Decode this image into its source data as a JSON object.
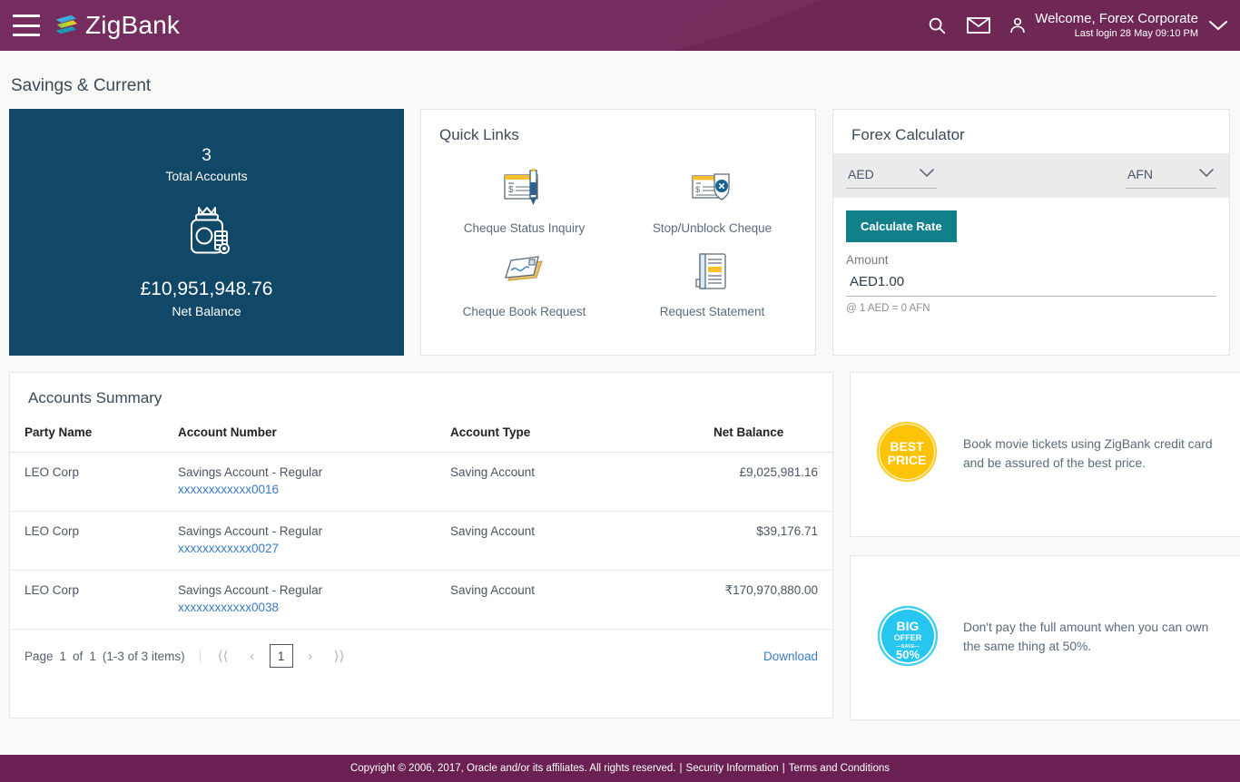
{
  "header": {
    "menu_icon": "hamburger-icon",
    "brand": "ZigBank",
    "search_icon": "search-icon",
    "mail_icon": "envelope-icon",
    "user_icon": "user-avatar-icon",
    "welcome": "Welcome, Forex Corporate",
    "last_login": "Last login 28 May 09:10 PM",
    "caret_icon": "chevron-down-icon",
    "brand_color": "#6b2053"
  },
  "page": {
    "title": "Savings & Current"
  },
  "balance_card": {
    "accounts_count": "3",
    "accounts_label": "Total Accounts",
    "icon": "money-jar-icon",
    "net_balance": "£10,951,948.76",
    "net_balance_label": "Net Balance",
    "bg_color": "#114868"
  },
  "quick_links": {
    "title": "Quick Links",
    "items": [
      {
        "label": "Cheque Status Inquiry",
        "icon": "cheque-pen-icon"
      },
      {
        "label": "Stop/Unblock Cheque",
        "icon": "cheque-block-icon"
      },
      {
        "label": "Cheque Book Request",
        "icon": "cheque-book-icon"
      },
      {
        "label": "Request Statement",
        "icon": "statement-document-icon"
      }
    ]
  },
  "forex": {
    "title": "Forex Calculator",
    "from_currency": "AED",
    "to_currency": "AFN",
    "calculate_label": "Calculate Rate",
    "amount_label": "Amount",
    "amount_value": "AED1.00",
    "rate_note": "@ 1 AED = 0 AFN",
    "button_color": "#12808a"
  },
  "accounts_summary": {
    "title": "Accounts Summary",
    "columns": [
      "Party Name",
      "Account Number",
      "Account Type",
      "Net Balance"
    ],
    "rows": [
      {
        "party": "LEO Corp",
        "account_name": "Savings Account - Regular",
        "account_number": "xxxxxxxxxxxx0016",
        "type": "Saving Account",
        "balance": "£9,025,981.16"
      },
      {
        "party": "LEO Corp",
        "account_name": "Savings Account - Regular",
        "account_number": "xxxxxxxxxxxx0027",
        "type": "Saving Account",
        "balance": "$39,176.71"
      },
      {
        "party": "LEO Corp",
        "account_name": "Savings Account - Regular",
        "account_number": "xxxxxxxxxxxx0038",
        "type": "Saving Account",
        "balance": "₹170,970,880.00"
      }
    ],
    "pagination": {
      "page_word": "Page",
      "current_page": "1",
      "of_word": "of",
      "total_pages": "1",
      "items_text": "(1-3 of 3 items)",
      "first_icon": "first-page-icon",
      "prev_icon": "prev-page-icon",
      "page_number": "1",
      "next_icon": "next-page-icon",
      "last_icon": "last-page-icon"
    },
    "download_label": "Download"
  },
  "promos": [
    {
      "badge_icon": "best-price-badge",
      "badge_line1": "BEST",
      "badge_line2": "PRICE",
      "badge_color": "#fdc407",
      "text": "Book movie tickets using ZigBank credit card and be assured of the best price."
    },
    {
      "badge_icon": "big-offer-badge",
      "badge_line1": "BIG",
      "badge_line2": "OFFER",
      "badge_line3": "SAVE",
      "badge_line4": "50%",
      "badge_color": "#26c6f0",
      "text": "Don't pay the full amount when you can own the same thing at 50%."
    }
  ],
  "footer": {
    "copyright": "Copyright © 2006, 2017, Oracle and/or its affiliates. All rights reserved.",
    "security_link": "Security Information",
    "terms_link": "Terms and Conditions",
    "separator": "|"
  }
}
